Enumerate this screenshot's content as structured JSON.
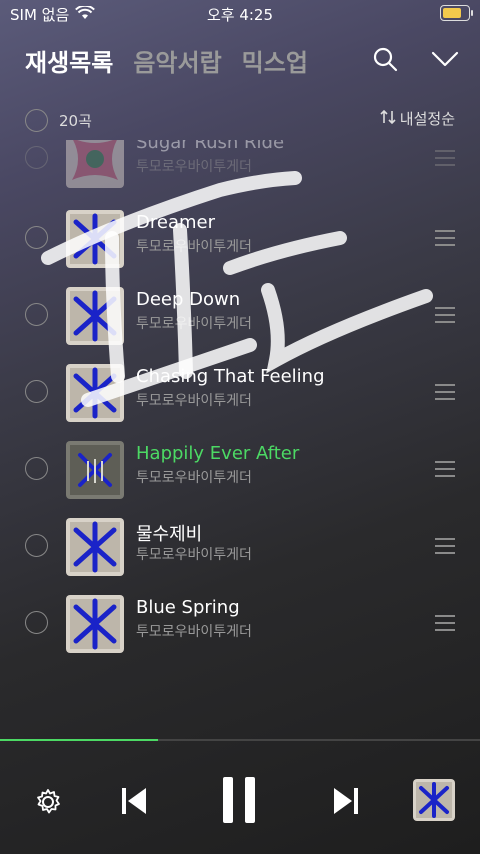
{
  "status_bar": {
    "carrier": "SIM 없음",
    "time": "오후 4:25",
    "battery_level": 0.8
  },
  "header": {
    "tabs": [
      {
        "label": "재생목록",
        "active": true
      },
      {
        "label": "음악서랍",
        "active": false
      },
      {
        "label": "믹스업",
        "active": false
      }
    ]
  },
  "toolbar": {
    "count": "20곡",
    "sort_label": "내설정순"
  },
  "tracks": [
    {
      "title": "Sugar Rush Ride",
      "artist": "투모로우바이투게더",
      "playing": false
    },
    {
      "title": "Dreamer",
      "artist": "투모로우바이투게더",
      "playing": false
    },
    {
      "title": "Deep Down",
      "artist": "투모로우바이투게더",
      "playing": false
    },
    {
      "title": "Chasing That Feeling",
      "artist": "투모로우바이투게더",
      "playing": false
    },
    {
      "title": "Happily Ever After",
      "artist": "투모로우바이투게더",
      "playing": true
    },
    {
      "title": "물수제비",
      "artist": "투모로우바이투게더",
      "playing": false
    },
    {
      "title": "Blue Spring",
      "artist": "투모로우바이투게더",
      "playing": false
    }
  ],
  "player": {
    "progress": 0.33
  },
  "colors": {
    "accent": "#4cd964",
    "playing_title": "#4cd964",
    "album_mark": "#1a23c8",
    "battery": "#f2c94c"
  }
}
